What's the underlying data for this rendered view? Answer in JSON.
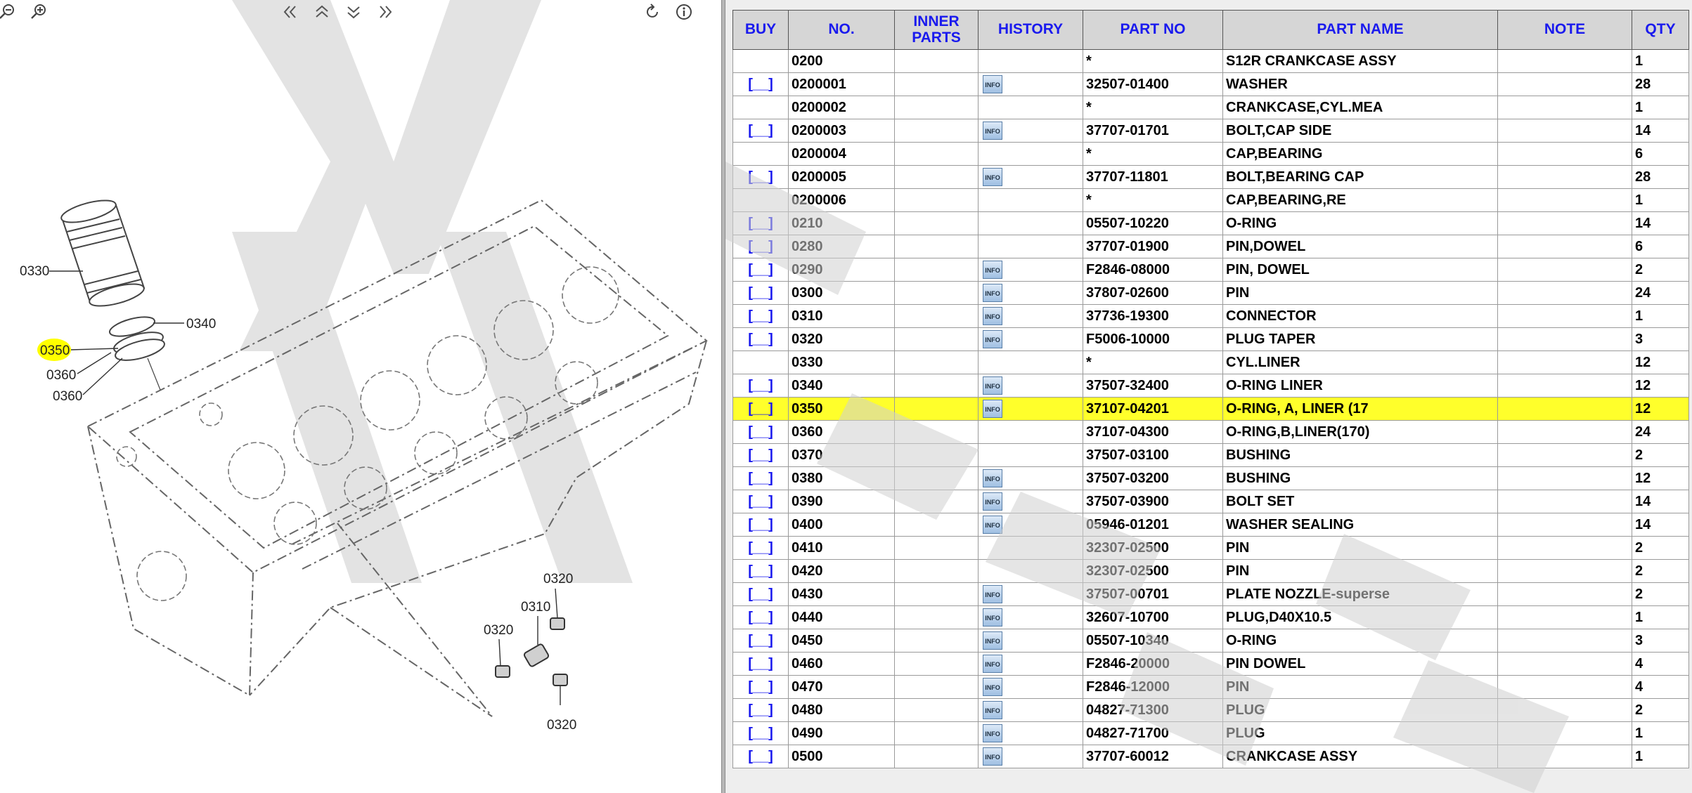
{
  "toolbar": {
    "zoom_out_icon": "zoom-out-icon",
    "zoom_in_icon": "zoom-in-icon",
    "first_icon": "double-chevron-left-icon",
    "up_icon": "double-chevron-up-icon",
    "down_icon": "double-chevron-down-icon",
    "last_icon": "double-chevron-right-icon",
    "reset_icon": "rotate-icon",
    "info_icon": "info-icon"
  },
  "diagram": {
    "callouts": [
      "0330",
      "0340",
      "0350",
      "0360",
      "0360",
      "0320",
      "0310",
      "0320",
      "0320"
    ],
    "highlight_color": "#ffff00"
  },
  "watermark": {
    "text": "YUHANG"
  },
  "table": {
    "headers": {
      "buy": "BUY",
      "no": "NO.",
      "inner": "INNER PARTS",
      "history": "HISTORY",
      "part_no": "PART NO",
      "part_name": "PART NAME",
      "note": "NOTE",
      "qty": "QTY"
    },
    "buy_label": "[__]",
    "info_label": "INFO",
    "highlight_color": "#ffff2b",
    "rows": [
      {
        "buy": false,
        "no": "0200",
        "info": false,
        "part_no": "*",
        "name": "S12R CRANKCASE ASSY",
        "note": "",
        "qty": "1"
      },
      {
        "buy": true,
        "no": "0200001",
        "info": true,
        "part_no": "32507-01400",
        "name": "WASHER",
        "note": "",
        "qty": "28"
      },
      {
        "buy": false,
        "no": "0200002",
        "info": false,
        "part_no": "*",
        "name": "CRANKCASE,CYL.MEA",
        "note": "",
        "qty": "1"
      },
      {
        "buy": true,
        "no": "0200003",
        "info": true,
        "part_no": "37707-01701",
        "name": "BOLT,CAP SIDE",
        "note": "",
        "qty": "14"
      },
      {
        "buy": false,
        "no": "0200004",
        "info": false,
        "part_no": "*",
        "name": "CAP,BEARING",
        "note": "",
        "qty": "6"
      },
      {
        "buy": true,
        "no": "0200005",
        "info": true,
        "part_no": "37707-11801",
        "name": "BOLT,BEARING CAP",
        "note": "",
        "qty": "28"
      },
      {
        "buy": false,
        "no": "0200006",
        "info": false,
        "part_no": "*",
        "name": "CAP,BEARING,RE",
        "note": "",
        "qty": "1"
      },
      {
        "buy": true,
        "no": "0210",
        "info": false,
        "part_no": "05507-10220",
        "name": "O-RING",
        "note": "",
        "qty": "14"
      },
      {
        "buy": true,
        "no": "0280",
        "info": false,
        "part_no": "37707-01900",
        "name": "PIN,DOWEL",
        "note": "",
        "qty": "6"
      },
      {
        "buy": true,
        "no": "0290",
        "info": true,
        "part_no": "F2846-08000",
        "name": "PIN, DOWEL",
        "note": "",
        "qty": "2"
      },
      {
        "buy": true,
        "no": "0300",
        "info": true,
        "part_no": "37807-02600",
        "name": "PIN",
        "note": "",
        "qty": "24"
      },
      {
        "buy": true,
        "no": "0310",
        "info": true,
        "part_no": "37736-19300",
        "name": "CONNECTOR",
        "note": "",
        "qty": "1"
      },
      {
        "buy": true,
        "no": "0320",
        "info": true,
        "part_no": "F5006-10000",
        "name": "PLUG TAPER",
        "note": "",
        "qty": "3"
      },
      {
        "buy": false,
        "no": "0330",
        "info": false,
        "part_no": "*",
        "name": "CYL.LINER",
        "note": "",
        "qty": "12"
      },
      {
        "buy": true,
        "no": "0340",
        "info": true,
        "part_no": "37507-32400",
        "name": "O-RING LINER",
        "note": "",
        "qty": "12"
      },
      {
        "buy": true,
        "no": "0350",
        "info": true,
        "part_no": "37107-04201",
        "name": "O-RING, A, LINER (17",
        "note": "",
        "qty": "12",
        "highlight": true
      },
      {
        "buy": true,
        "no": "0360",
        "info": false,
        "part_no": "37107-04300",
        "name": "O-RING,B,LINER(170)",
        "note": "",
        "qty": "24"
      },
      {
        "buy": true,
        "no": "0370",
        "info": false,
        "part_no": "37507-03100",
        "name": "BUSHING",
        "note": "",
        "qty": "2"
      },
      {
        "buy": true,
        "no": "0380",
        "info": true,
        "part_no": "37507-03200",
        "name": "BUSHING",
        "note": "",
        "qty": "12"
      },
      {
        "buy": true,
        "no": "0390",
        "info": true,
        "part_no": "37507-03900",
        "name": "BOLT SET",
        "note": "",
        "qty": "14"
      },
      {
        "buy": true,
        "no": "0400",
        "info": true,
        "part_no": "05946-01201",
        "name": "WASHER SEALING",
        "note": "",
        "qty": "14"
      },
      {
        "buy": true,
        "no": "0410",
        "info": false,
        "part_no": "32307-02500",
        "name": "PIN",
        "note": "",
        "qty": "2"
      },
      {
        "buy": true,
        "no": "0420",
        "info": false,
        "part_no": "32307-02500",
        "name": "PIN",
        "note": "",
        "qty": "2"
      },
      {
        "buy": true,
        "no": "0430",
        "info": true,
        "part_no": "37507-00701",
        "name": "PLATE NOZZLE-superse",
        "note": "",
        "qty": "2"
      },
      {
        "buy": true,
        "no": "0440",
        "info": true,
        "part_no": "32607-10700",
        "name": "PLUG,D40X10.5",
        "note": "",
        "qty": "1"
      },
      {
        "buy": true,
        "no": "0450",
        "info": true,
        "part_no": "05507-10340",
        "name": "O-RING",
        "note": "",
        "qty": "3"
      },
      {
        "buy": true,
        "no": "0460",
        "info": true,
        "part_no": "F2846-20000",
        "name": "PIN DOWEL",
        "note": "",
        "qty": "4"
      },
      {
        "buy": true,
        "no": "0470",
        "info": true,
        "part_no": "F2846-12000",
        "name": "PIN",
        "note": "",
        "qty": "4"
      },
      {
        "buy": true,
        "no": "0480",
        "info": true,
        "part_no": "04827-71300",
        "name": "PLUG",
        "note": "",
        "qty": "2"
      },
      {
        "buy": true,
        "no": "0490",
        "info": true,
        "part_no": "04827-71700",
        "name": "PLUG",
        "note": "",
        "qty": "1"
      },
      {
        "buy": true,
        "no": "0500",
        "info": true,
        "part_no": "37707-60012",
        "name": "CRANKCASE ASSY",
        "note": "",
        "qty": "1"
      }
    ]
  }
}
